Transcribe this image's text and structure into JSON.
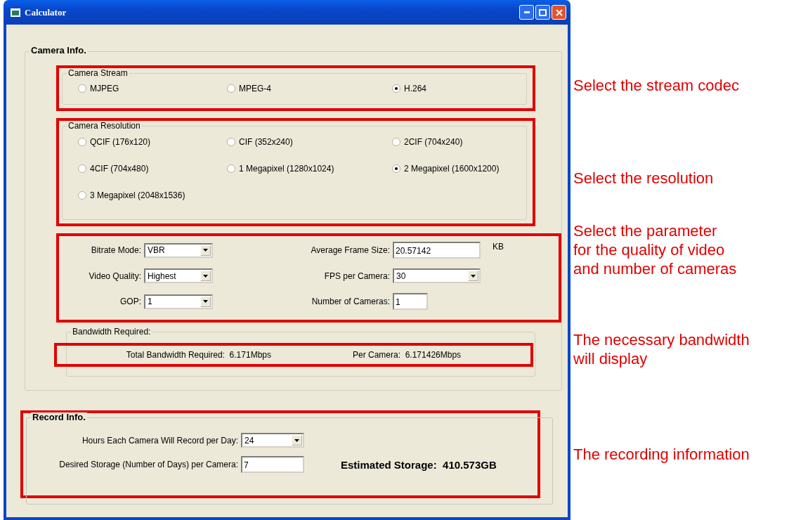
{
  "window": {
    "title": "Calculator"
  },
  "camera_info": {
    "title": "Camera Info.",
    "stream": {
      "title": "Camera Stream",
      "options": [
        {
          "label": "MJPEG",
          "selected": false
        },
        {
          "label": "MPEG-4",
          "selected": false
        },
        {
          "label": "H.264",
          "selected": true
        }
      ]
    },
    "resolution": {
      "title": "Camera Resolution",
      "options": [
        {
          "label": "QCIF (176x120)",
          "selected": false
        },
        {
          "label": "CIF (352x240)",
          "selected": false
        },
        {
          "label": "2CIF (704x240)",
          "selected": false
        },
        {
          "label": "4CIF (704x480)",
          "selected": false
        },
        {
          "label": "1 Megapixel (1280x1024)",
          "selected": false
        },
        {
          "label": "2 Megapixel (1600x1200)",
          "selected": true
        },
        {
          "label": "3 Megapixel (2048x1536)",
          "selected": false
        }
      ]
    },
    "parameters": [
      {
        "label": "Bitrate Mode:",
        "kind": "dropdown",
        "value": "VBR"
      },
      {
        "label": "Average Frame Size:",
        "kind": "field",
        "value": "20.57142",
        "unit": "KB"
      },
      {
        "label": "Video Quality:",
        "kind": "dropdown",
        "value": "Highest"
      },
      {
        "label": "FPS per Camera:",
        "kind": "dropdown",
        "value": "30"
      },
      {
        "label": "GOP:",
        "kind": "dropdown",
        "value": "1"
      },
      {
        "label": "Number of Cameras:",
        "kind": "field",
        "value": "1"
      }
    ],
    "bandwidth": {
      "title": "Bandwidth Required:",
      "total_label": "Total Bandwidth Required:",
      "total_value": "6.171Mbps",
      "per_camera_label": "Per Camera:",
      "per_camera_value": "6.171426Mbps"
    }
  },
  "record_info": {
    "title": "Record Info.",
    "fields": [
      {
        "label": "Hours Each Camera Will Record per Day:",
        "kind": "dropdown",
        "value": "24"
      },
      {
        "label": "Desired Storage (Number of Days) per Camera:",
        "kind": "field",
        "value": "7"
      }
    ],
    "estimated_label": "Estimated Storage:",
    "estimated_value": "410.573GB"
  },
  "annotations": [
    {
      "lines": [
        "Select the stream codec"
      ]
    },
    {
      "lines": [
        "Select the resolution"
      ]
    },
    {
      "lines": [
        "Select the parameter",
        "for the quality of video",
        "and number of cameras"
      ]
    },
    {
      "lines": [
        "The necessary bandwidth",
        "will display"
      ]
    },
    {
      "lines": [
        "The recording information"
      ]
    }
  ]
}
